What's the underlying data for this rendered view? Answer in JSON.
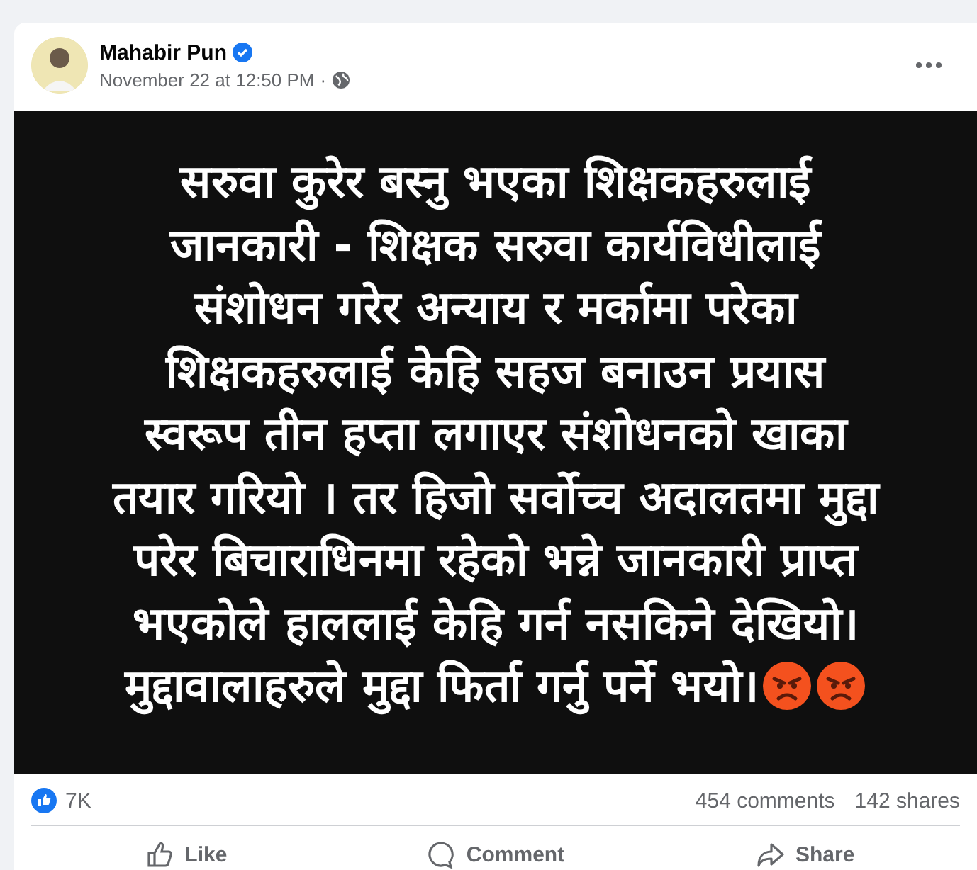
{
  "post": {
    "author": "Mahabir Pun",
    "verified": true,
    "timestamp": "November 22 at 12:50 PM",
    "separator": "·",
    "audience_public": true,
    "image_lines": [
      "सरुवा कुरेर बस्नु भएका शिक्षकहरुलाई",
      "जानकारी - शिक्षक सरुवा कार्यविधीलाई",
      "संशोधन गरेर अन्याय र मर्कामा परेका",
      "शिक्षकहरुलाई केहि सहज बनाउन प्रयास",
      "स्वरूप तीन हप्ता लगाएर संशोधनको खाका",
      "तयार गरियो । तर हिजो सर्वोच्च अदालतमा मुद्दा",
      "परेर बिचाराधिनमा रहेको भन्ने जानकारी प्राप्त",
      "भएकोले हाललाई केहि गर्न नसकिने देखियो।",
      "मुद्दावालाहरुले मुद्दा फिर्ता गर्नु पर्ने भयो।"
    ],
    "emojis": [
      {
        "kind": "angry"
      },
      {
        "kind": "angry"
      }
    ],
    "reactions": {
      "count": "7K"
    },
    "comments": "454 comments",
    "shares": "142 shares",
    "actions": [
      {
        "kind": "like",
        "label": "Like"
      },
      {
        "kind": "comment",
        "label": "Comment"
      },
      {
        "kind": "share",
        "label": "Share"
      }
    ]
  }
}
